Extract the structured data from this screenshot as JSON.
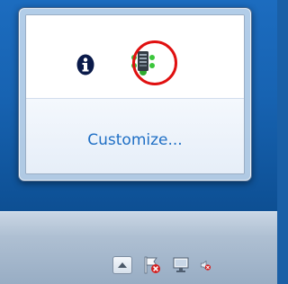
{
  "overflow_popup": {
    "icons": [
      "info-icon",
      "app-status-icon"
    ],
    "customize_label": "Customize...",
    "highlight_color": "#e01010"
  },
  "taskbar": {
    "tray_icons": [
      "show-hidden-icons-icon",
      "action-center-flag-error-icon",
      "network-error-icon",
      "speaker-muted-icon"
    ]
  },
  "colors": {
    "desktop": "#1763b2",
    "link": "#1f6fc5",
    "taskbar": "#aebfd2"
  }
}
